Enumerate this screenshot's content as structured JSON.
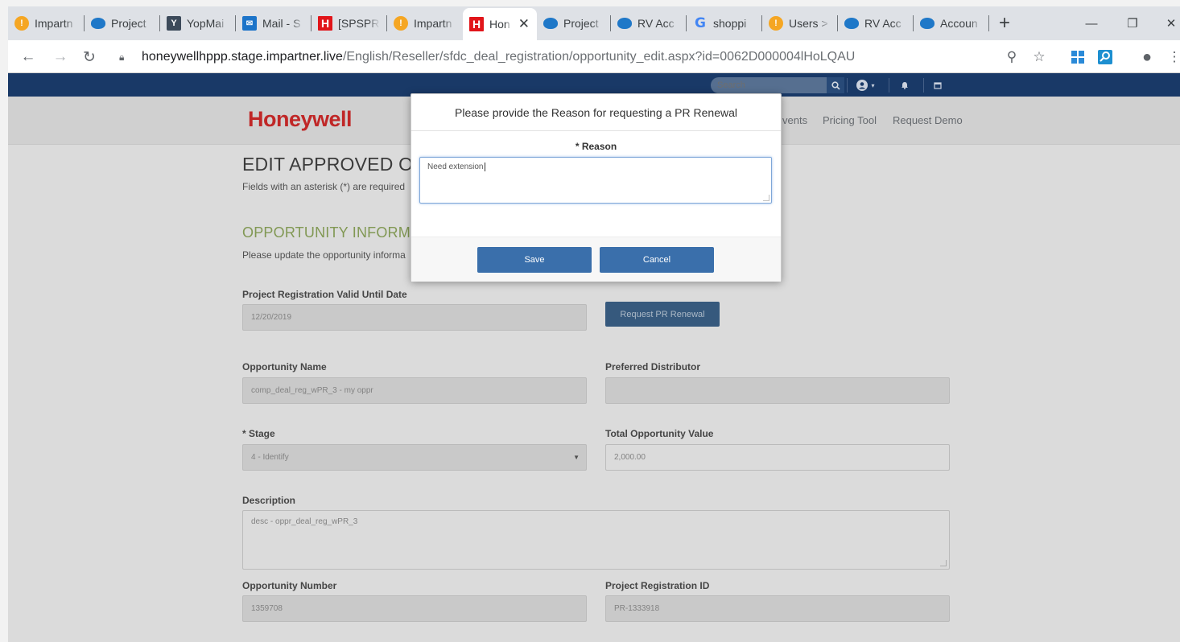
{
  "browser": {
    "tabs": [
      {
        "label": "Impartn",
        "icon": "impartner-icon"
      },
      {
        "label": "Project",
        "icon": "salesforce-icon"
      },
      {
        "label": "YopMai",
        "icon": "yopmail-icon"
      },
      {
        "label": "Mail - S",
        "icon": "mail-icon"
      },
      {
        "label": "[SPSPR",
        "icon": "honeywell-icon"
      },
      {
        "label": "Impartn",
        "icon": "impartner-icon"
      },
      {
        "label": "Hon",
        "icon": "honeywell-icon",
        "active": true
      },
      {
        "label": "Project",
        "icon": "salesforce-icon"
      },
      {
        "label": "RV Acc",
        "icon": "salesforce-icon"
      },
      {
        "label": "shoppi",
        "icon": "google-icon"
      },
      {
        "label": "Users >",
        "icon": "impartner-icon"
      },
      {
        "label": "RV Acc",
        "icon": "salesforce-icon"
      },
      {
        "label": "Accoun",
        "icon": "salesforce-icon"
      }
    ],
    "url_host": "honeywellhppp.stage.impartner.live",
    "url_path": "/English/Reseller/sfdc_deal_registration/opportunity_edit.aspx?id=0062D000004lHoLQAU"
  },
  "site": {
    "search_placeholder": "Search",
    "logo": "Honeywell",
    "nav": [
      "vents",
      "Pricing Tool",
      "Request Demo"
    ]
  },
  "form": {
    "title": "EDIT APPROVED OP",
    "subtitle": "Fields with an asterisk (*) are required",
    "section_title": "OPPORTUNITY INFORMAT",
    "section_sub": "Please update the opportunity informa",
    "pr_valid_label": "Project Registration Valid Until Date",
    "pr_valid_value": "12/20/2019",
    "request_pr_button": "Request PR Renewal",
    "opp_name_label": "Opportunity Name",
    "opp_name_value": "comp_deal_reg_wPR_3 - my oppr",
    "pref_dist_label": "Preferred Distributor",
    "pref_dist_value": "",
    "stage_label": "* Stage",
    "stage_value": "4 - Identify",
    "total_value_label": "Total Opportunity Value",
    "total_value_value": "2,000.00",
    "desc_label": "Description",
    "desc_value": "desc - oppr_deal_reg_wPR_3",
    "opp_number_label": "Opportunity Number",
    "opp_number_value": "1359708",
    "pr_id_label": "Project Registration ID",
    "pr_id_value": "PR-1333918"
  },
  "modal": {
    "title": "Please provide the Reason for requesting a PR Renewal",
    "reason_label": "* Reason",
    "reason_value": "Need extension",
    "save_label": "Save",
    "cancel_label": "Cancel"
  }
}
